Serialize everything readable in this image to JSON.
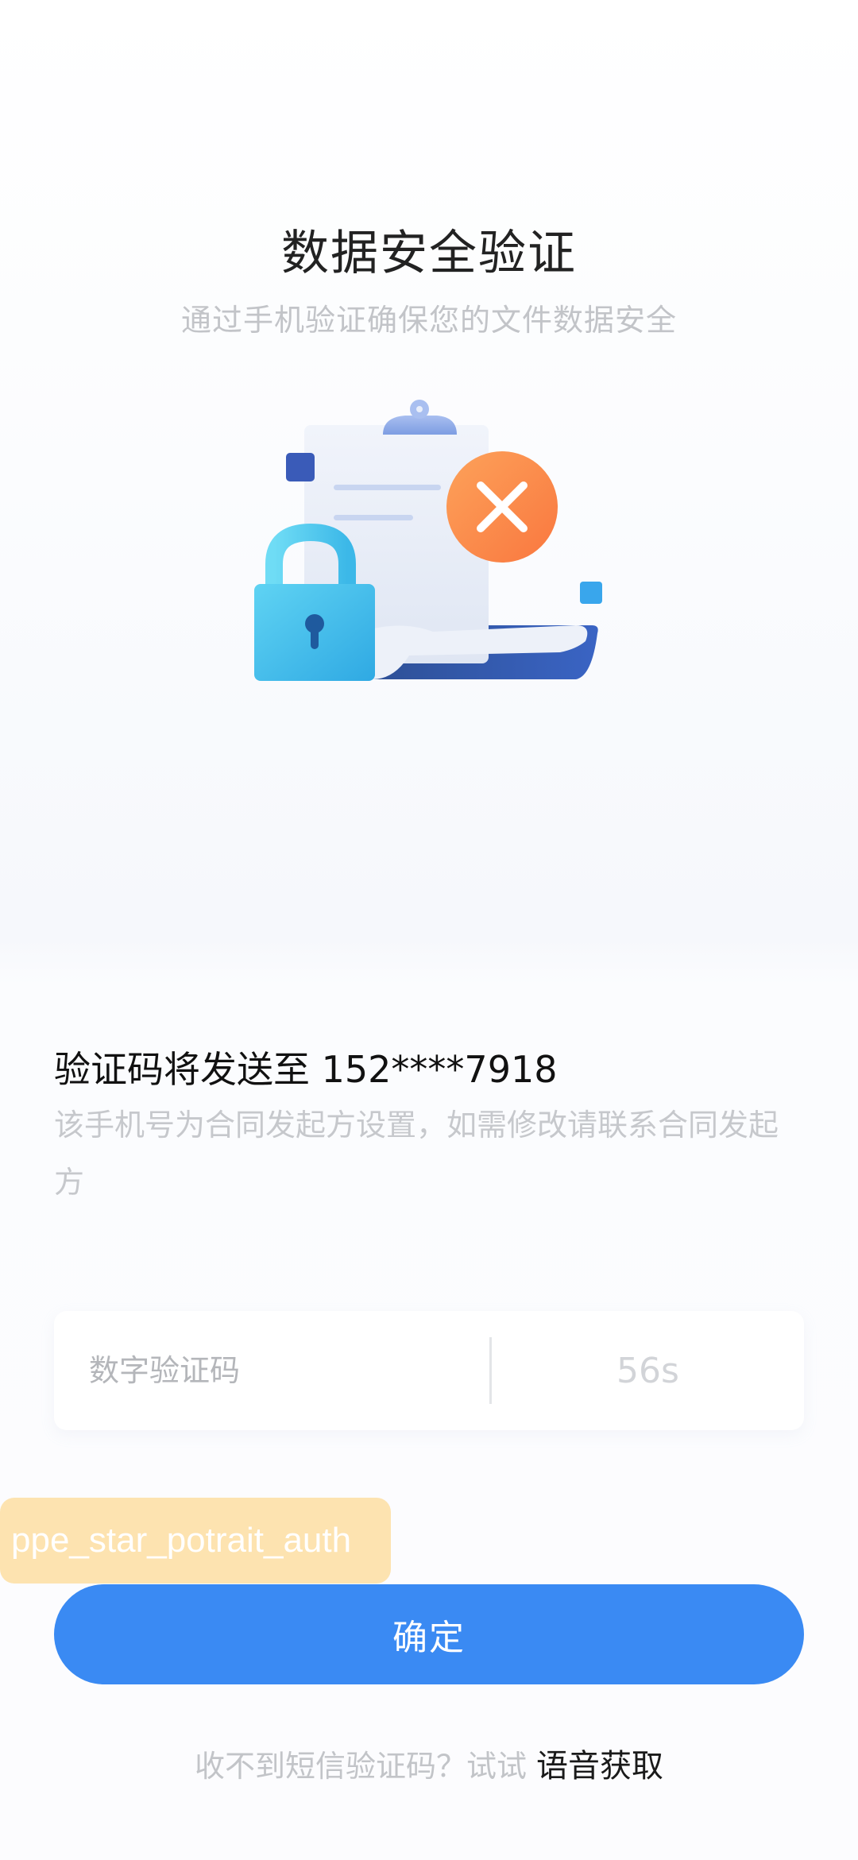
{
  "header": {
    "title": "数据安全验证",
    "subtitle": "通过手机验证确保您的文件数据安全"
  },
  "illustration": {
    "icons": [
      "clipboard-icon",
      "lock-icon",
      "close-icon"
    ],
    "colors": {
      "error_badge": "#fb8a4a",
      "lock": "#3fc4ec",
      "paper": "#e6ecf7"
    }
  },
  "verification": {
    "send_to_label": "验证码将发送至 152****7918",
    "note": "该手机号为合同发起方设置，如需修改请联系合同发起方",
    "code_placeholder": "数字验证码",
    "code_value": "",
    "countdown": "56s"
  },
  "debug_tag": "ppe_star_potrait_auth",
  "actions": {
    "confirm_label": "确定"
  },
  "footer": {
    "hint": "收不到短信验证码？试试",
    "voice_link": "语音获取"
  },
  "colors": {
    "primary": "#3a8af3",
    "muted_text": "#c2c4c8"
  }
}
